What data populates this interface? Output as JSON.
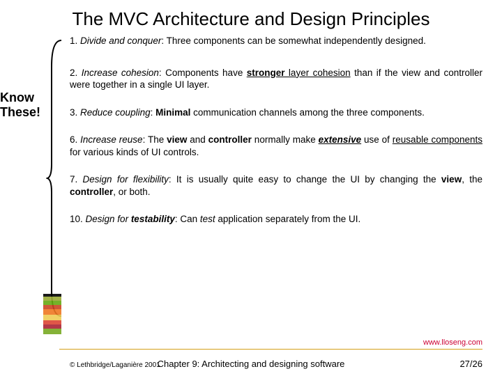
{
  "title": "The MVC Architecture and Design Principles",
  "annotation": {
    "line1": "Know",
    "line2": "These!"
  },
  "principles": {
    "p1": {
      "num": "1. ",
      "name": "Divide and conquer",
      "rest": ": Three components can be somewhat independently designed."
    },
    "p2": {
      "num": "2. ",
      "name": "Increase cohesion",
      "rest1": ": Components have ",
      "strong": "stronger",
      "rest2": " layer cohesion",
      "rest3": " than if the view and controller were together in a single UI layer."
    },
    "p3": {
      "num": "3. ",
      "name": "Reduce coupling",
      "rest1": ": ",
      "minimal": "Minimal",
      "rest2": " communication channels among the three components."
    },
    "p6": {
      "num": "6. ",
      "name": "Increase reuse",
      "rest1": ": The ",
      "view": "view",
      "rest2": " and ",
      "ctrl": "controller",
      "rest3": " normally make ",
      "ext": "extensive",
      "rest4": " use of ",
      "reusable": "reusable components",
      "rest5": " for various kinds of UI controls."
    },
    "p7": {
      "num": "7. ",
      "name": "Design for flexibility",
      "rest1": ": It is usually quite easy to change the UI by changing the ",
      "view": "view",
      "rest2": ", the ",
      "ctrl": "controller",
      "rest3": ", or both."
    },
    "p10": {
      "num": "10. ",
      "name1": "Design for ",
      "name2": "testability",
      "rest1": ": Can ",
      "test": "test",
      "rest2": " application separately from the UI."
    }
  },
  "url": "www.lloseng.com",
  "footer": {
    "copyright": "© Lethbridge/Laganière 2001",
    "chapter": "Chapter 9: Architecting and designing software",
    "page": "27/26"
  }
}
